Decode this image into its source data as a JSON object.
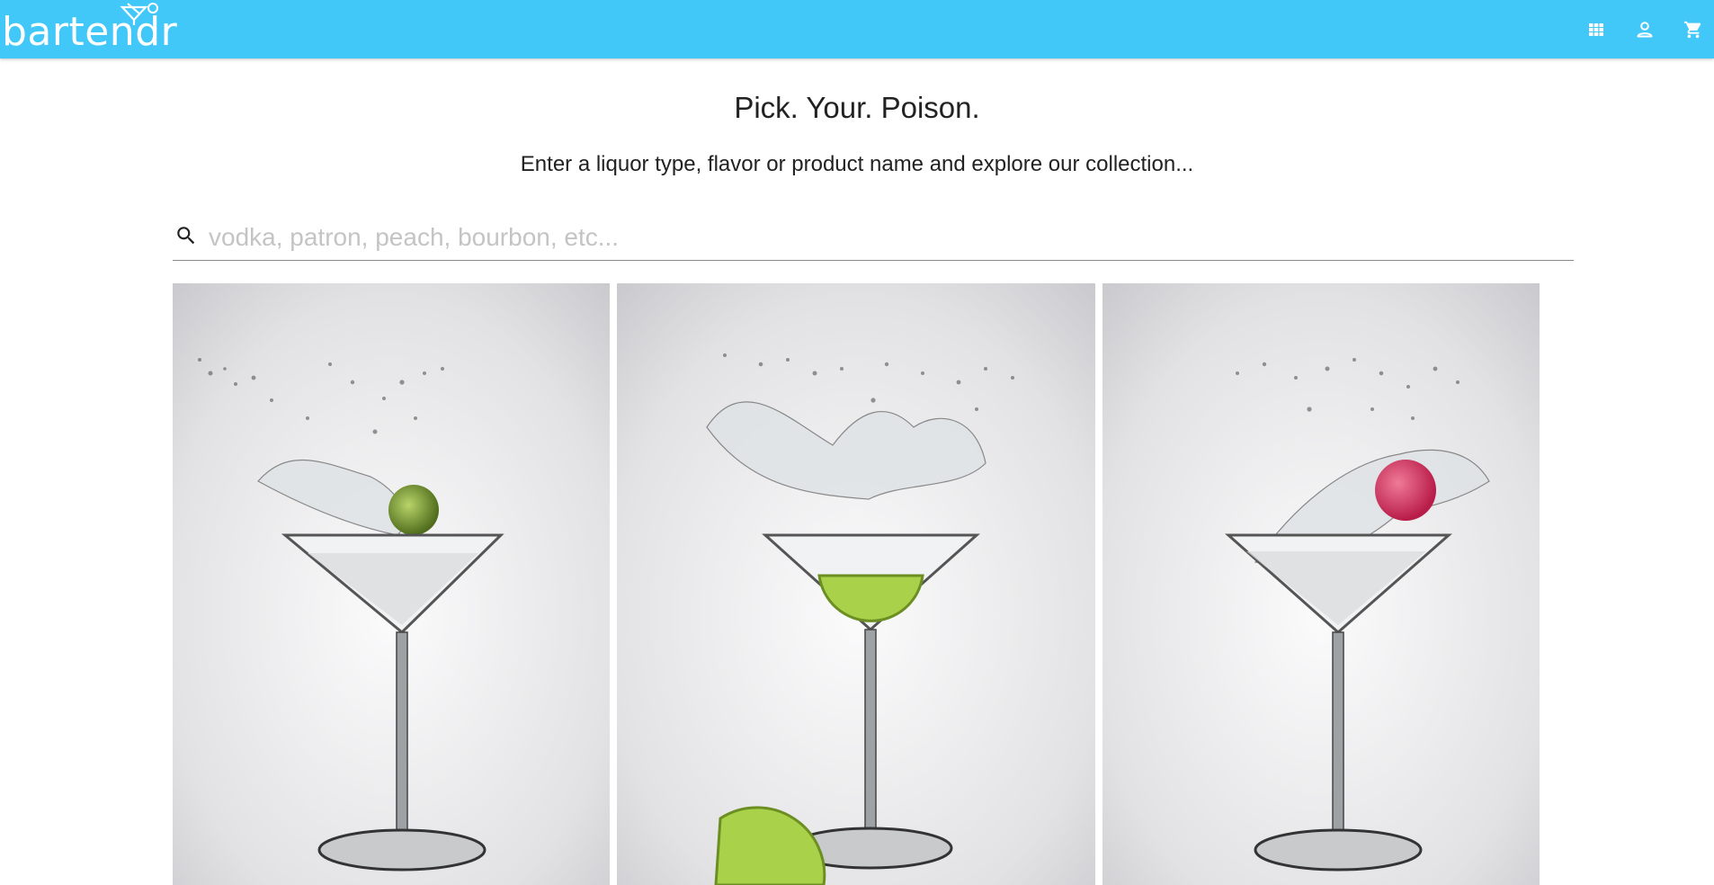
{
  "app": {
    "logo_text": "bartendr",
    "brand_color": "#41c8f8"
  },
  "nav": {
    "icons": [
      "grid-icon",
      "account-icon",
      "cart-icon"
    ]
  },
  "main": {
    "headline": "Pick. Your. Poison.",
    "subline": "Enter a liquor type, flavor or product name and explore our collection...",
    "search": {
      "placeholder": "vodka, patron, peach, bourbon, etc...",
      "value": ""
    },
    "gallery": [
      {
        "garnish": "green olive",
        "garnish_color": "#8fb13a"
      },
      {
        "garnish": "lime wedge",
        "garnish_color": "#a9d14a"
      },
      {
        "garnish": "red sphere",
        "garnish_color": "#d7345e"
      }
    ]
  }
}
